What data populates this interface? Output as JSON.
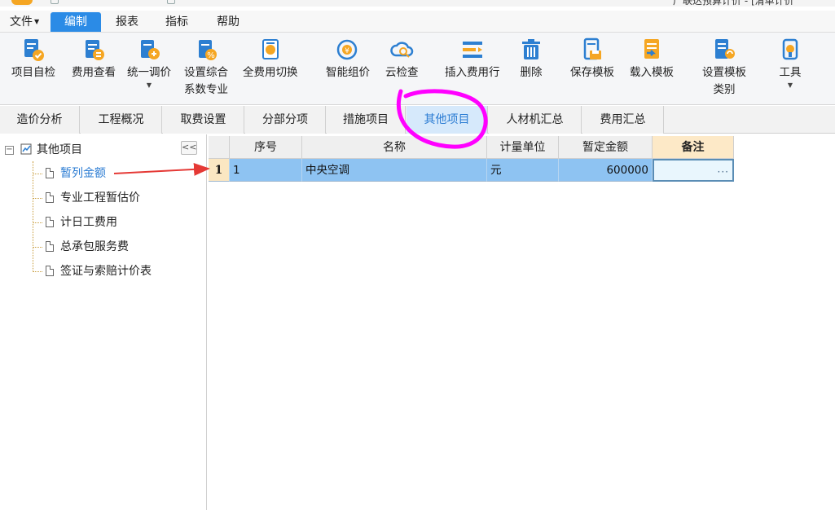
{
  "window": {
    "title": "广联达预算计价 - [清单计价"
  },
  "menu": [
    {
      "label": "文件",
      "has_dropdown": true
    },
    {
      "label": "编制",
      "active": true
    },
    {
      "label": "报表"
    },
    {
      "label": "指标"
    },
    {
      "label": "帮助"
    }
  ],
  "ribbon": [
    {
      "label": "项目自检",
      "icon": "check-doc-icon"
    },
    {
      "label": "费用查看",
      "icon": "view-cost-icon"
    },
    {
      "label": "统一调价",
      "icon": "price-adjust-icon",
      "has_dropdown": true
    },
    {
      "label": "设置综合系数专业",
      "line1": "设置综合",
      "line2": "系数专业",
      "icon": "percent-doc-icon"
    },
    {
      "label": "全费用切换",
      "icon": "switch-icon"
    },
    {
      "label": "智能组价",
      "icon": "smart-price-icon"
    },
    {
      "label": "云检查",
      "icon": "cloud-check-icon"
    },
    {
      "label": "插入费用行",
      "icon": "insert-row-icon"
    },
    {
      "label": "删除",
      "icon": "trash-icon"
    },
    {
      "label": "保存模板",
      "icon": "save-template-icon"
    },
    {
      "label": "载入模板",
      "icon": "load-template-icon"
    },
    {
      "label": "设置模板类别",
      "line1": "设置模板",
      "line2": "类别",
      "icon": "template-category-icon"
    },
    {
      "label": "工具",
      "icon": "tools-icon",
      "has_dropdown": true
    }
  ],
  "subtabs": [
    "造价分析",
    "工程概况",
    "取费设置",
    "分部分项",
    "措施项目",
    "其他项目",
    "人材机汇总",
    "费用汇总"
  ],
  "active_subtab": "其他项目",
  "tree": {
    "root": "其他项目",
    "collapse_label": "<<",
    "children": [
      "暂列金额",
      "专业工程暂估价",
      "计日工费用",
      "总承包服务费",
      "签证与索赔计价表"
    ],
    "selected": "暂列金额"
  },
  "grid": {
    "columns": [
      "序号",
      "名称",
      "计量单位",
      "暂定金额",
      "备注"
    ],
    "rows": [
      {
        "row_number": "1",
        "seq": "1",
        "name": "中央空调",
        "unit": "元",
        "amount": "600000",
        "note": "···"
      }
    ]
  },
  "colors": {
    "accent": "#2b8be6",
    "selected_row": "#8ec3f2",
    "annotation_circle": "#ff00ff",
    "annotation_arrow": "#e53935"
  }
}
